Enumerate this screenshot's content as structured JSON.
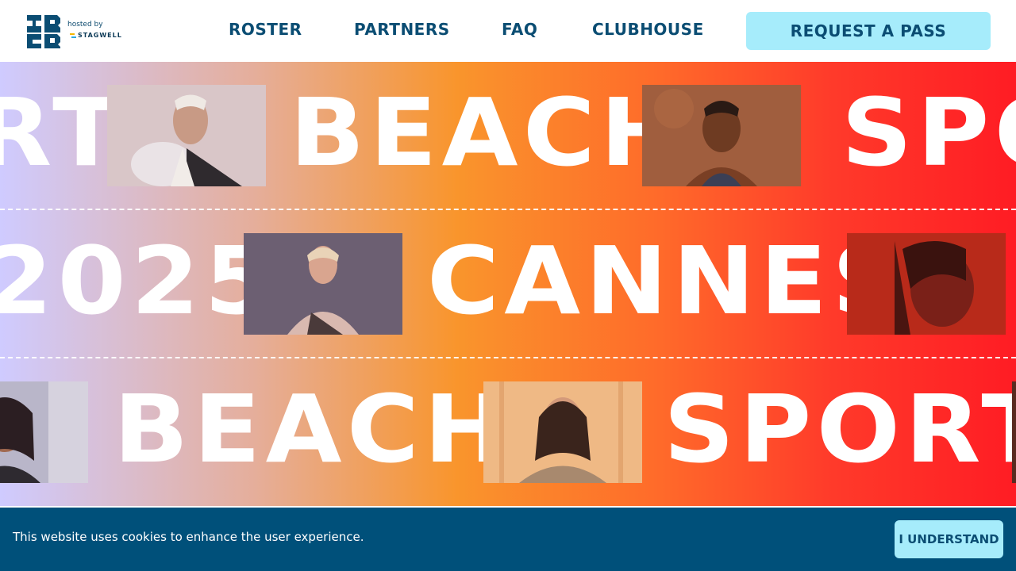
{
  "brand": {
    "hosted_by": "hosted by",
    "partner": "STAGWELL"
  },
  "nav": {
    "items": [
      "ROSTER",
      "PARTNERS",
      "FAQ",
      "CLUBHOUSE"
    ],
    "cta": "REQUEST A PASS"
  },
  "hero": {
    "row1": {
      "word_a": "RT",
      "word_b": "BEACH",
      "word_c": "SPO"
    },
    "row2": {
      "word_a": "2025",
      "word_b": "CANNES"
    },
    "row3": {
      "word_a": "BEACH",
      "word_b": "SPORT"
    }
  },
  "cookie": {
    "message": "This website uses cookies to enhance the user experience.",
    "button": "I UNDERSTAND"
  },
  "colors": {
    "primary": "#0b4d73",
    "accent": "#a6ecfb",
    "banner": "#00507a"
  }
}
